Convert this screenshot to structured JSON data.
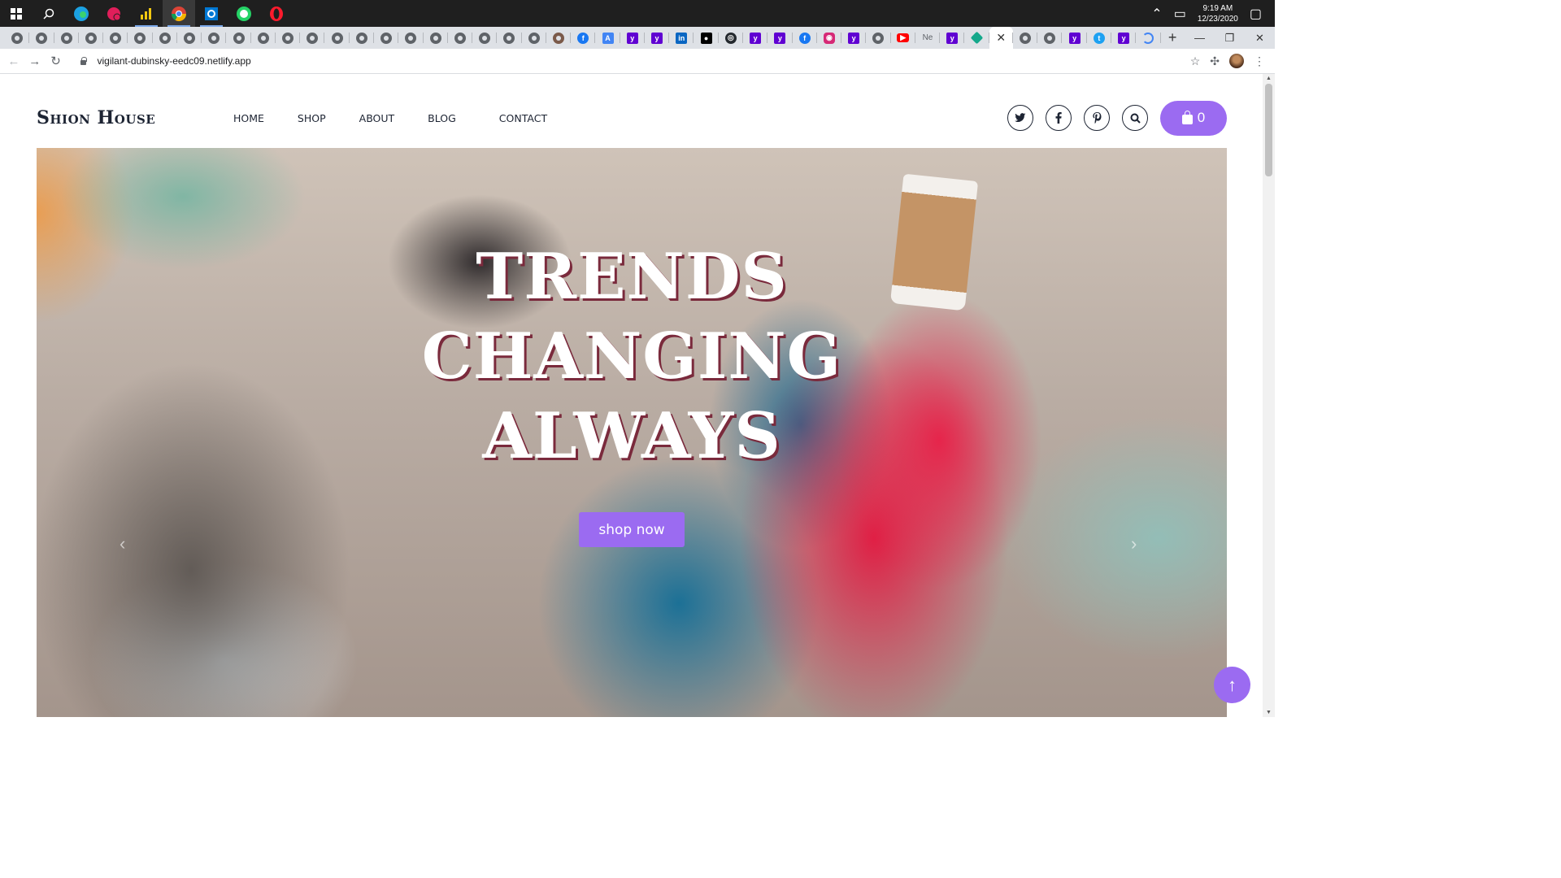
{
  "taskbar": {
    "clock_time": "9:19 AM",
    "clock_date": "12/23/2020"
  },
  "browser": {
    "url": "vigilant-dubinsky-eedc09.netlify.app",
    "tab_text_ne": "Ne",
    "new_tab": "+"
  },
  "site": {
    "logo": "Shion House",
    "nav": {
      "home": "HOME",
      "shop": "SHOP",
      "about": "ABOUT",
      "blog": "BLOG",
      "contact": "CONTACT"
    },
    "cart_count": "0",
    "colors": {
      "accent": "#9b6bf1",
      "text_dark": "#1d2433"
    }
  },
  "hero": {
    "title_line1": "TRENDS",
    "title_line2": "CHANGING",
    "title_line3": "ALWAYS",
    "cta_label": "shop now"
  }
}
